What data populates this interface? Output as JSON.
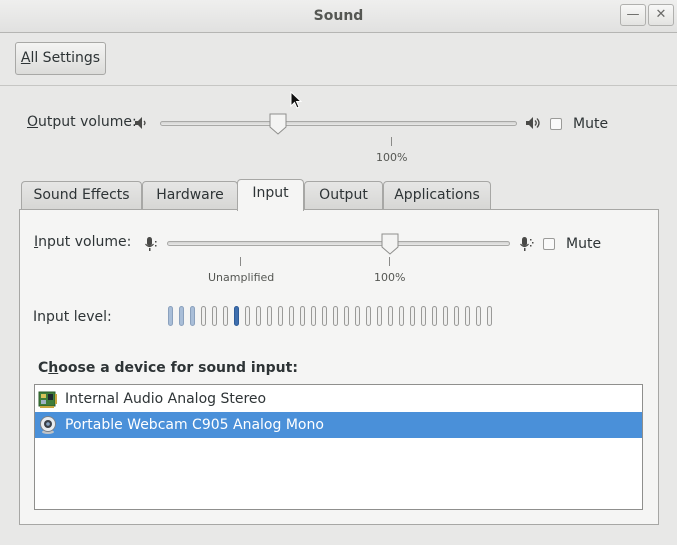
{
  "window": {
    "title": "Sound",
    "minimize_glyph": "—",
    "close_glyph": "✕"
  },
  "toolbar": {
    "all_settings_mnemonic": "A",
    "all_settings_rest": "ll Settings"
  },
  "output": {
    "label_mnemonic": "O",
    "label_rest": "utput volume:",
    "low_icon": "speaker-low-icon",
    "high_icon": "speaker-high-icon",
    "volume_fraction": 0.33,
    "mark_label": "100%",
    "mute_label": "Mute",
    "muted": false
  },
  "tabs": [
    {
      "label": "Sound Effects",
      "active": false
    },
    {
      "label": "Hardware",
      "active": false
    },
    {
      "label": "Input",
      "active": true
    },
    {
      "label": "Output",
      "active": false
    },
    {
      "label": "Applications",
      "active": false
    }
  ],
  "input": {
    "label_mnemonic": "I",
    "label_rest": "nput volume:",
    "low_icon": "microphone-low-icon",
    "high_icon": "microphone-high-icon",
    "volume_fraction": 0.65,
    "mark_unamplified": "Unamplified",
    "mark_100": "100%",
    "mute_label": "Mute",
    "muted": false,
    "level_label": "Input level:",
    "level_segments": 30,
    "level_lit": 3,
    "level_peak_index": 6
  },
  "devices": {
    "heading_pre": "C",
    "heading_mnemonic": "h",
    "heading_rest": "oose a device for sound input:",
    "items": [
      {
        "label": "Internal Audio Analog Stereo",
        "icon": "sound-card-icon",
        "selected": false
      },
      {
        "label": "Portable Webcam C905 Analog Mono",
        "icon": "webcam-icon",
        "selected": true
      }
    ]
  },
  "colors": {
    "selection": "#4a90d9",
    "level_active": "#a9bed8",
    "level_peak": "#3f6fae"
  }
}
